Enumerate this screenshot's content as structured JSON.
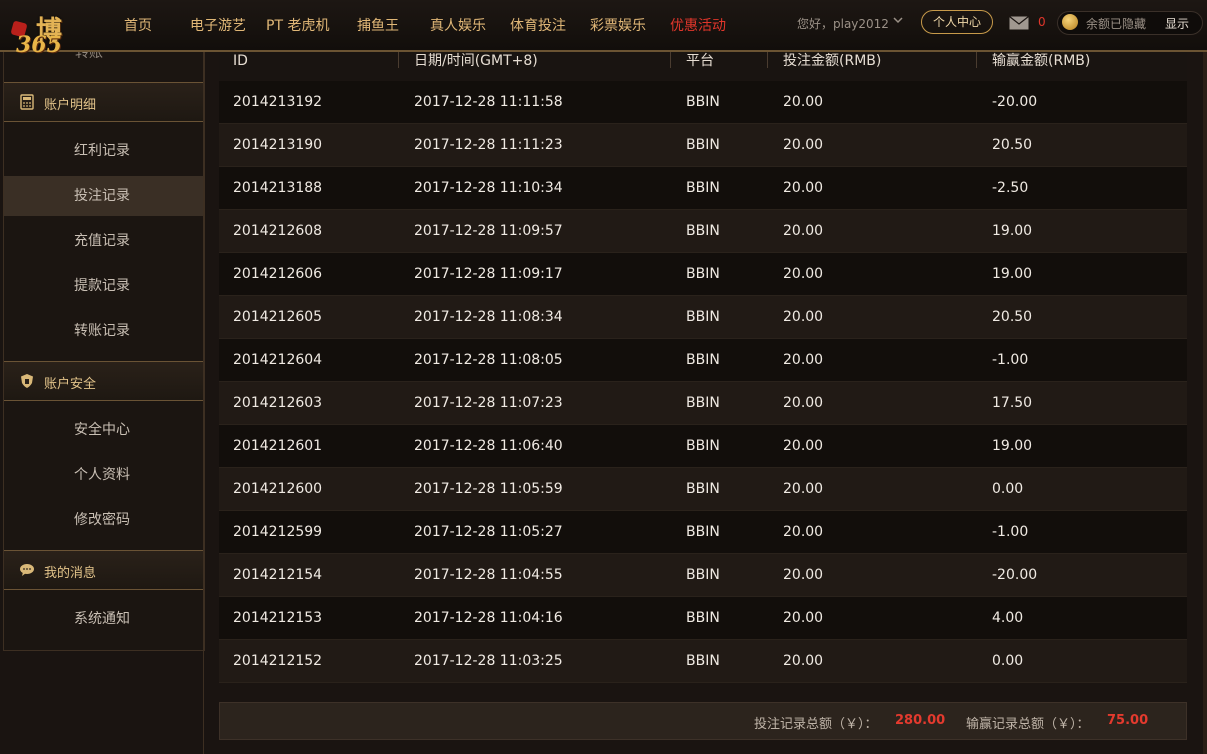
{
  "brand": {
    "logo_text": "博",
    "logo_num": "365"
  },
  "nav": {
    "items": [
      "首页",
      "电子游艺",
      "PT 老虎机",
      "捕鱼王",
      "真人娱乐",
      "体育投注",
      "彩票娱乐",
      "优惠活动"
    ]
  },
  "user": {
    "greeting": "您好，play2012",
    "center_button": "个人中心",
    "mail_count": "0",
    "balance_text": "余额已隐藏",
    "show_button": "显示"
  },
  "sidebar": {
    "stub_label": "转账",
    "sections": [
      {
        "title": "账户明细",
        "icon": "calculator-icon",
        "items": [
          "红利记录",
          "投注记录",
          "充值记录",
          "提款记录",
          "转账记录"
        ]
      },
      {
        "title": "账户安全",
        "icon": "shield-icon",
        "items": [
          "安全中心",
          "个人资料",
          "修改密码"
        ]
      },
      {
        "title": "我的消息",
        "icon": "chat-bubble-icon",
        "items": [
          "系统通知"
        ]
      }
    ],
    "active_item": "投注记录"
  },
  "table": {
    "headers": [
      "ID",
      "日期/时间(GMT+8)",
      "平台",
      "投注金额(RMB)",
      "输赢金额(RMB)"
    ],
    "rows": [
      [
        "2014213192",
        "2017-12-28 11:11:58",
        "BBIN",
        "20.00",
        "-20.00"
      ],
      [
        "2014213190",
        "2017-12-28 11:11:23",
        "BBIN",
        "20.00",
        "20.50"
      ],
      [
        "2014213188",
        "2017-12-28 11:10:34",
        "BBIN",
        "20.00",
        "-2.50"
      ],
      [
        "2014212608",
        "2017-12-28 11:09:57",
        "BBIN",
        "20.00",
        "19.00"
      ],
      [
        "2014212606",
        "2017-12-28 11:09:17",
        "BBIN",
        "20.00",
        "19.00"
      ],
      [
        "2014212605",
        "2017-12-28 11:08:34",
        "BBIN",
        "20.00",
        "20.50"
      ],
      [
        "2014212604",
        "2017-12-28 11:08:05",
        "BBIN",
        "20.00",
        "-1.00"
      ],
      [
        "2014212603",
        "2017-12-28 11:07:23",
        "BBIN",
        "20.00",
        "17.50"
      ],
      [
        "2014212601",
        "2017-12-28 11:06:40",
        "BBIN",
        "20.00",
        "19.00"
      ],
      [
        "2014212600",
        "2017-12-28 11:05:59",
        "BBIN",
        "20.00",
        "0.00"
      ],
      [
        "2014212599",
        "2017-12-28 11:05:27",
        "BBIN",
        "20.00",
        "-1.00"
      ],
      [
        "2014212154",
        "2017-12-28 11:04:55",
        "BBIN",
        "20.00",
        "-20.00"
      ],
      [
        "2014212153",
        "2017-12-28 11:04:16",
        "BBIN",
        "20.00",
        "4.00"
      ],
      [
        "2014212152",
        "2017-12-28 11:03:25",
        "BBIN",
        "20.00",
        "0.00"
      ]
    ]
  },
  "summary": {
    "bet_label": "投注记录总额（￥）：",
    "bet_total": "280.00",
    "win_label": "输赢记录总额（￥）：",
    "win_total": "75.00"
  },
  "colors": {
    "accent": "#e0b777",
    "promo": "#e0362b",
    "total": "#e43a2e"
  }
}
